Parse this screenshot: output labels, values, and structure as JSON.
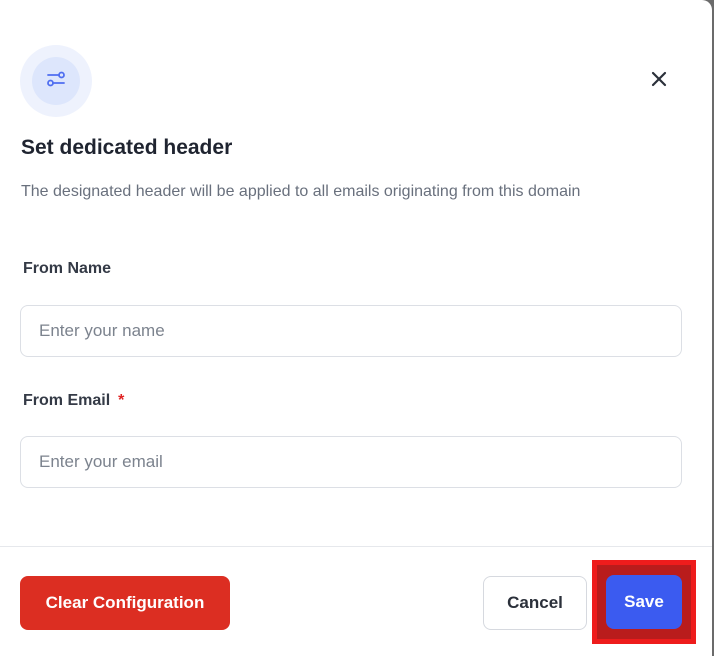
{
  "modal": {
    "title": "Set dedicated header",
    "subtitle": "The designated header will be applied to all emails originating from this domain",
    "header_icon": "settings-sliders-icon",
    "close_icon": "close-icon"
  },
  "form": {
    "from_name": {
      "label": "From Name",
      "placeholder": "Enter your name",
      "value": ""
    },
    "from_email": {
      "label": "From Email",
      "required_marker": "*",
      "placeholder": "Enter your email",
      "value": ""
    }
  },
  "footer": {
    "clear_label": "Clear Configuration",
    "cancel_label": "Cancel",
    "save_label": "Save"
  },
  "colors": {
    "accent": "#3b5bf0",
    "danger": "#dc2e22",
    "highlight": "#ee1c1c"
  }
}
